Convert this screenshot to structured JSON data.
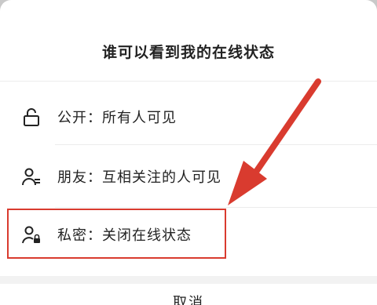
{
  "dialog": {
    "title": "谁可以看到我的在线状态",
    "options": [
      {
        "label": "公开：所有人可见",
        "icon": "unlock-icon"
      },
      {
        "label": "朋友：互相关注的人可见",
        "icon": "user-friends-icon"
      },
      {
        "label": "私密：关闭在线状态",
        "icon": "user-lock-icon"
      }
    ],
    "cancel_label": "取消"
  },
  "annotation": {
    "arrow_color": "#d93b2f",
    "highlight_color": "#d93b2f",
    "highlighted_option": "私密：关闭在线状态"
  }
}
